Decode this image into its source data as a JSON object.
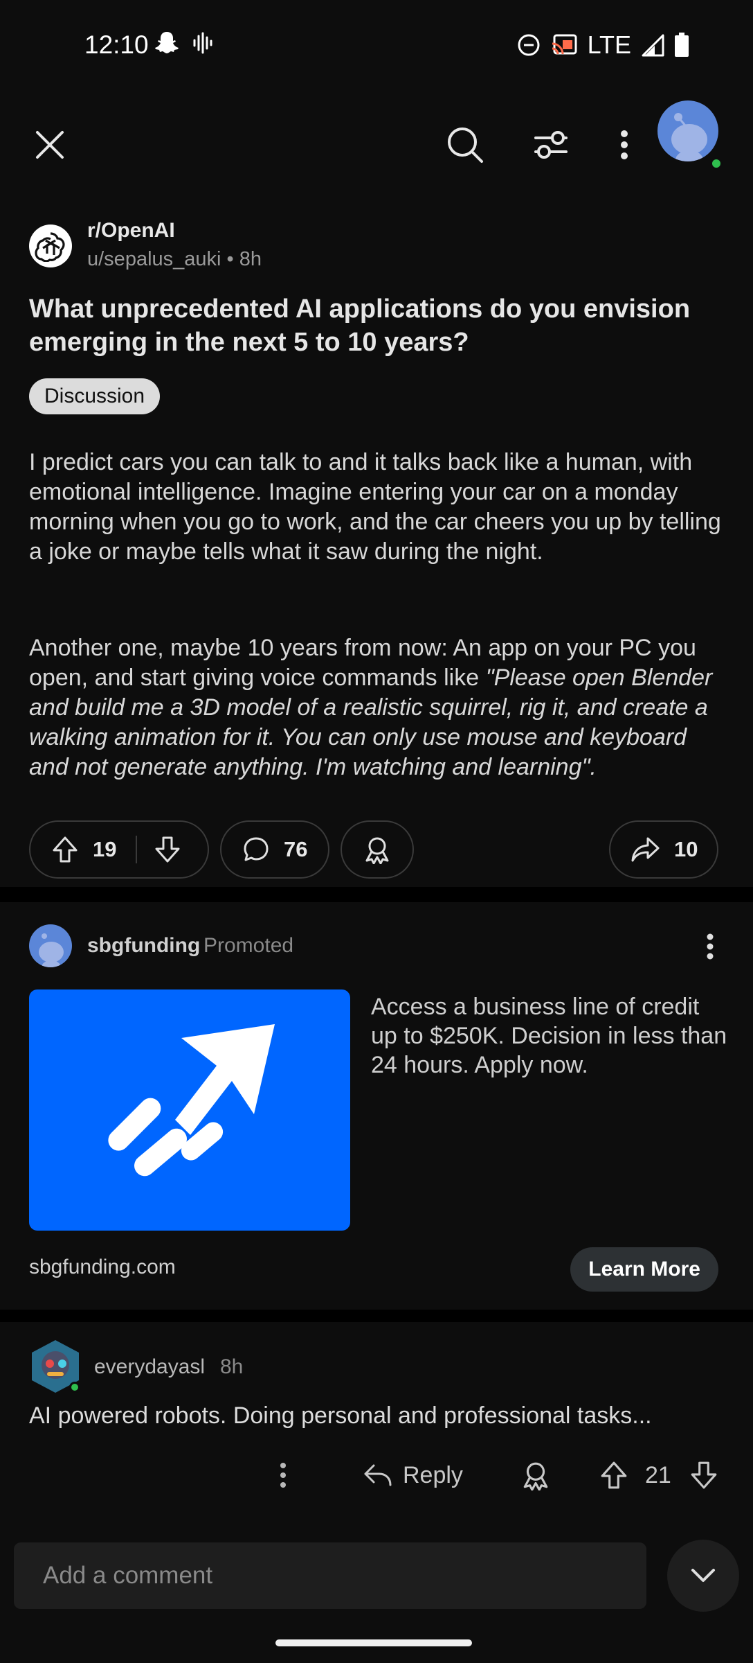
{
  "status_bar": {
    "time": "12:10",
    "network": "LTE"
  },
  "topbar": {
    "icons": [
      "close-icon",
      "search-icon",
      "filter-icon",
      "more-vertical-icon",
      "avatar"
    ]
  },
  "post": {
    "subreddit": "r/OpenAI",
    "author_meta": "u/sepalus_auki • 8h",
    "title": "What unprecedented AI applications do you envision emerging in the next 5 to 10 years?",
    "flair": "Discussion",
    "body_p1": "I predict cars you can talk to and it talks back like a human, with emotional intelligence. Imagine entering your car on a monday morning when you go to work, and the car cheers you up by telling a joke or maybe tells what it saw during the night.",
    "body_p2_plain": "Another one, maybe 10 years from now: An app on your PC you open, and start giving voice commands like ",
    "body_p2_italic": "\"Please open Blender and build me a 3D model of a realistic squirrel, rig it, and create a walking animation for it. You can only use mouse and keyboard and not generate anything. I'm watching and learning\".",
    "upvotes": "19",
    "comments": "76",
    "shares": "10"
  },
  "ad": {
    "advertiser": "sbgfunding",
    "promoted_label": "Promoted",
    "copy": "Access a business line of credit up to $250K. Decision in less than 24 hours. Apply now.",
    "domain": "sbgfunding.com",
    "cta": "Learn More",
    "image_color": "#0066ff"
  },
  "comment": {
    "author": "everydayasl",
    "time": "8h",
    "text": "AI powered robots. Doing personal and professional tasks...",
    "reply_label": "Reply",
    "votes": "21"
  },
  "composer": {
    "placeholder": "Add a comment"
  }
}
